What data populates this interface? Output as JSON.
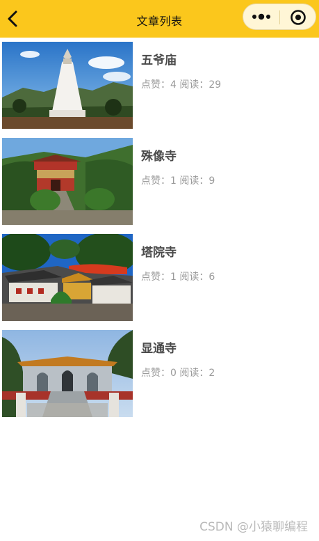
{
  "nav": {
    "title": "文章列表",
    "back_icon": "chevron-left-icon",
    "more_icon": "more-dots-icon",
    "close_icon": "target-close-icon",
    "bar_color": "#fbc71c"
  },
  "articles": [
    {
      "title": "五爷庙",
      "likes_label": "点赞：",
      "likes": "4",
      "reads_label": "阅读：",
      "reads": "29",
      "image": "white-stupa-temple-photo"
    },
    {
      "title": "殊像寺",
      "likes_label": "点赞：",
      "likes": "1",
      "reads_label": "阅读：",
      "reads": "9",
      "image": "red-gate-temple-photo"
    },
    {
      "title": "塔院寺",
      "likes_label": "点赞：",
      "likes": "1",
      "reads_label": "阅读：",
      "reads": "6",
      "image": "temple-roofs-photo"
    },
    {
      "title": "显通寺",
      "likes_label": "点赞：",
      "likes": "0",
      "reads_label": "阅读：",
      "reads": "2",
      "image": "stone-hall-temple-photo"
    }
  ],
  "watermark": "CSDN @小猿聊编程"
}
